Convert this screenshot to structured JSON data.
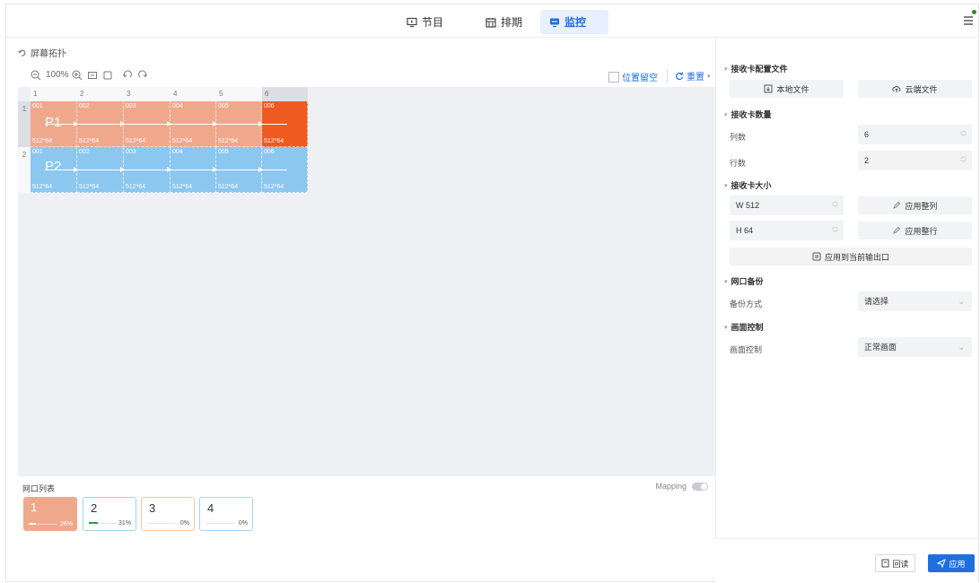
{
  "header": {
    "tabs": [
      {
        "label": "节目",
        "icon": "monitor-play-icon",
        "active": false
      },
      {
        "label": "排期",
        "icon": "calendar-icon",
        "active": true
      },
      {
        "label": "监控",
        "icon": "monitor-icon",
        "active": true
      }
    ]
  },
  "back": {
    "label": "屏幕拓扑",
    "icon": "back-arrow-icon"
  },
  "toolbar": {
    "zoom": "100%",
    "position_reserve": "位置留空",
    "reset": "重置"
  },
  "grid": {
    "columns": [
      "1",
      "2",
      "3",
      "4",
      "5",
      "6"
    ],
    "rows": [
      "1",
      "2"
    ],
    "selected_column": "6",
    "panels": [
      {
        "label": "P1",
        "color": "#f0a88d",
        "highlight_color": "#ef5a20",
        "cells": [
          {
            "id": "001",
            "size": "512*64"
          },
          {
            "id": "002",
            "size": "512*64"
          },
          {
            "id": "003",
            "size": "512*64"
          },
          {
            "id": "004",
            "size": "512*64"
          },
          {
            "id": "005",
            "size": "512*64"
          },
          {
            "id": "006",
            "size": "512*64"
          }
        ]
      },
      {
        "label": "P2",
        "color": "#8cc7f0",
        "highlight_color": "#8cc7f0",
        "cells": [
          {
            "id": "001",
            "size": "512*64"
          },
          {
            "id": "002",
            "size": "512*64"
          },
          {
            "id": "003",
            "size": "512*64"
          },
          {
            "id": "004",
            "size": "512*64"
          },
          {
            "id": "005",
            "size": "512*64"
          },
          {
            "id": "006",
            "size": "512*64"
          }
        ]
      }
    ]
  },
  "ports": {
    "title": "网口列表",
    "mapping_label": "Mapping",
    "mapping_enabled": false,
    "items": [
      {
        "num": "1",
        "pct": "26%",
        "value": 0.26,
        "active": true,
        "accent": "#f0a88d"
      },
      {
        "num": "2",
        "pct": "31%",
        "value": 0.31,
        "active": false,
        "accent": "#2c9b4a"
      },
      {
        "num": "3",
        "pct": "0%",
        "value": 0,
        "active": false,
        "accent": "#f0c8a8"
      },
      {
        "num": "4",
        "pct": "0%",
        "value": 0,
        "active": false,
        "accent": "#a8d4f0"
      }
    ]
  },
  "panel": {
    "receiver_config": {
      "title": "接收卡配置文件",
      "local_file": "本地文件",
      "cloud_file": "云端文件"
    },
    "receiver_count": {
      "title": "接收卡数量",
      "cols_label": "列数",
      "cols_value": "6",
      "rows_label": "行数",
      "rows_value": "2"
    },
    "receiver_size": {
      "title": "接收卡大小",
      "width": "W 512",
      "height": "H 64",
      "apply_col": "应用整列",
      "apply_row": "应用整行",
      "apply_output": "应用到当前输出口"
    },
    "port_backup": {
      "title": "网口备份",
      "method_label": "备份方式",
      "method_value": "请选择"
    },
    "picture_control": {
      "title": "画面控制",
      "label": "画面控制",
      "value": "正常画面"
    }
  },
  "footer": {
    "readback": "回读",
    "apply": "应用"
  },
  "colors": {
    "accent": "#1f6fe0",
    "panel_p1": "#f0a88d",
    "panel_p1_selected": "#ef5a20",
    "panel_p2": "#8cc7f0"
  }
}
